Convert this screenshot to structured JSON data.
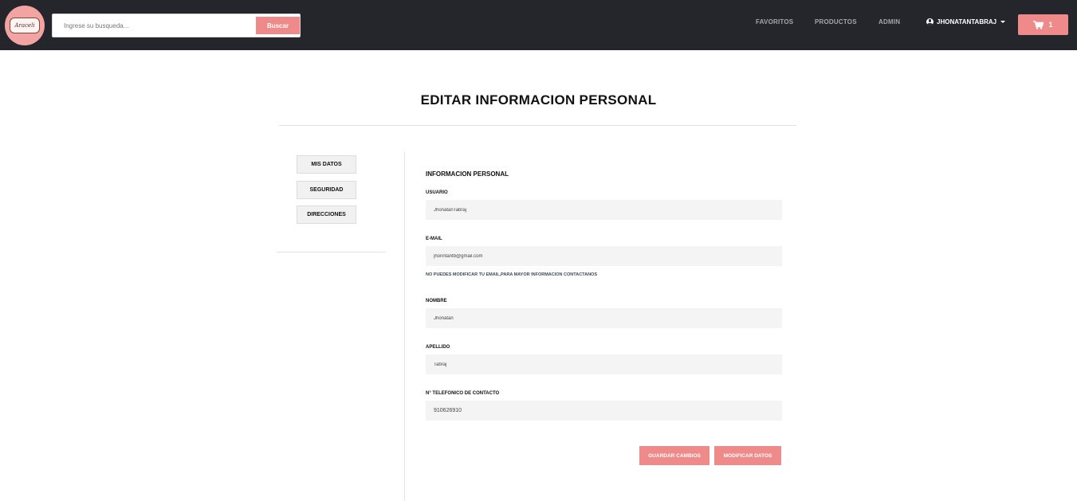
{
  "header": {
    "logo_text": "Araceli",
    "search": {
      "placeholder": "Ingrese su busqueda...",
      "value": "",
      "button_label": "Buscar"
    },
    "nav": [
      {
        "label": "FAVORITOS"
      },
      {
        "label": "PRODUCTOS"
      },
      {
        "label": "ADMIN"
      }
    ],
    "user": {
      "label": "JHONATANTABRAJ"
    },
    "cart": {
      "count": "1"
    },
    "colors": {
      "background": "#24262b",
      "accent": "#ee8a8a"
    }
  },
  "page": {
    "title": "EDITAR INFORMACION PERSONAL"
  },
  "sidebar": {
    "items": [
      {
        "label": "MIS DATOS"
      },
      {
        "label": "SEGURIDAD"
      },
      {
        "label": "DIRECCIONES"
      }
    ]
  },
  "form": {
    "section_title": "INFORMACION PERSONAL",
    "usuario": {
      "label": "USUARIO",
      "value": "JhonatanTabraj"
    },
    "email": {
      "label": "E-MAIL",
      "value": "jhonntantb@gmail.com",
      "note": "NO PUEDES MODIFICAR TU EMAIL,PARA MAYOR INFORMACION CONTACTANOS"
    },
    "nombre": {
      "label": "NOMBRE",
      "value": "Jhonatan"
    },
    "apellido": {
      "label": "APELLIDO",
      "value": "Tabraj"
    },
    "telefono": {
      "label": "N° TELEFONICO DE CONTACTO",
      "value": "910626910"
    },
    "save_label": "GUARDAR CAMBIOS",
    "edit_label": "MODIFICAR DATOS"
  }
}
